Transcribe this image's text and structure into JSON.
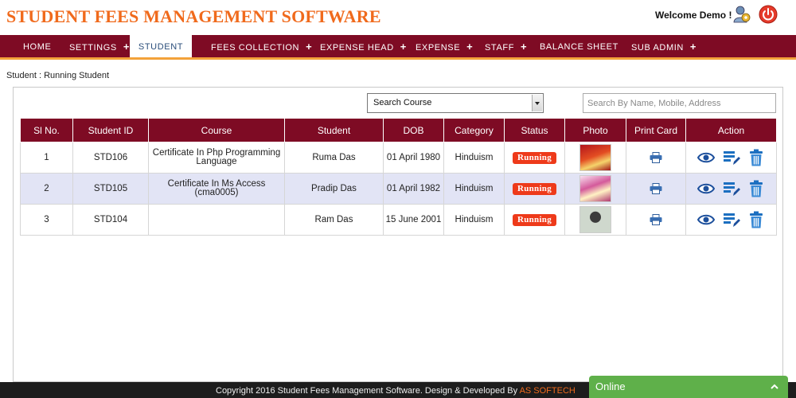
{
  "header": {
    "title": "STUDENT FEES MANAGEMENT SOFTWARE",
    "welcome": "Welcome Demo !",
    "icons": {
      "user": "user-settings-icon",
      "logout": "power-icon"
    }
  },
  "nav": [
    {
      "label": "HOME",
      "has_submenu": false
    },
    {
      "label": "SETTINGS",
      "has_submenu": true
    },
    {
      "label": "STUDENT",
      "has_submenu": false,
      "active": true
    },
    {
      "label": "FEES COLLECTION",
      "has_submenu": true
    },
    {
      "label": "EXPENSE HEAD",
      "has_submenu": true
    },
    {
      "label": "EXPENSE",
      "has_submenu": true
    },
    {
      "label": "STAFF",
      "has_submenu": true
    },
    {
      "label": "BALANCE SHEET",
      "has_submenu": false
    },
    {
      "label": "SUB ADMIN",
      "has_submenu": true
    }
  ],
  "nav_plus": "+",
  "breadcrumb": "Student : Running Student",
  "filters": {
    "course_select": "Search Course",
    "search_placeholder": "Search By Name, Mobile, Address"
  },
  "table": {
    "columns": [
      "Sl No.",
      "Student ID",
      "Course",
      "Student",
      "DOB",
      "Category",
      "Status",
      "Photo",
      "Print Card",
      "Action"
    ],
    "rows": [
      {
        "sl": "1",
        "id": "STD106",
        "course": "Certificate In Php Programming Language",
        "student": "Ruma Das",
        "dob": "01 April 1980",
        "category": "Hinduism",
        "status": "Running"
      },
      {
        "sl": "2",
        "id": "STD105",
        "course": "Certificate In Ms Access (cma0005)",
        "student": "Pradip Das",
        "dob": "01 April 1982",
        "category": "Hinduism",
        "status": "Running"
      },
      {
        "sl": "3",
        "id": "STD104",
        "course": "",
        "student": "Ram Das",
        "dob": "15 June 2001",
        "category": "Hinduism",
        "status": "Running"
      }
    ]
  },
  "footer": {
    "copyright": "Copyright 2016 Student Fees Management Software. Design & Developed By",
    "developer": "AS SOFTECH"
  },
  "online": "Online",
  "colors": {
    "brand_maroon": "#7e0b24",
    "accent_orange": "#f06a1c",
    "status_red": "#ee3a1a",
    "online_green": "#5fb04a"
  }
}
